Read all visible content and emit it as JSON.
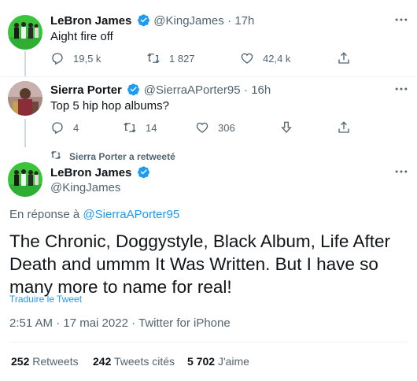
{
  "tweet1": {
    "name": "LeBron James",
    "handle": "@KingJames",
    "time": "17h",
    "text": "Aight fire off",
    "replies": "19,5 k",
    "retweets": "1 827",
    "likes": "42,4 k"
  },
  "tweet2": {
    "name": "Sierra Porter",
    "handle": "@SierraAPorter95",
    "time": "16h",
    "text": "Top 5 hip hop albums?",
    "replies": "4",
    "retweets": "14",
    "likes": "306"
  },
  "retweet_banner": "Sierra Porter a retweeté",
  "main_tweet": {
    "name": "LeBron James",
    "handle": "@KingJames",
    "reply_prefix": "En réponse à ",
    "reply_link": "@SierraAPorter95",
    "text": "The Chronic, Doggystyle, Black Album, Life After Death and ummm It Was Written. But I have so many more to name for real!",
    "translate": "Traduire le Tweet",
    "meta": "2:51 AM · 17 mai 2022 · Twitter for iPhone",
    "stats": {
      "retweets_count": "252",
      "retweets_label": "Retweets",
      "quotes_count": "242",
      "quotes_label": "Tweets cités",
      "likes_count": "5 702",
      "likes_label": "J'aime"
    }
  },
  "colors": {
    "accent": "#1d9bf0",
    "secondary_text": "#536471",
    "avatar_green": "#3ec33a"
  }
}
